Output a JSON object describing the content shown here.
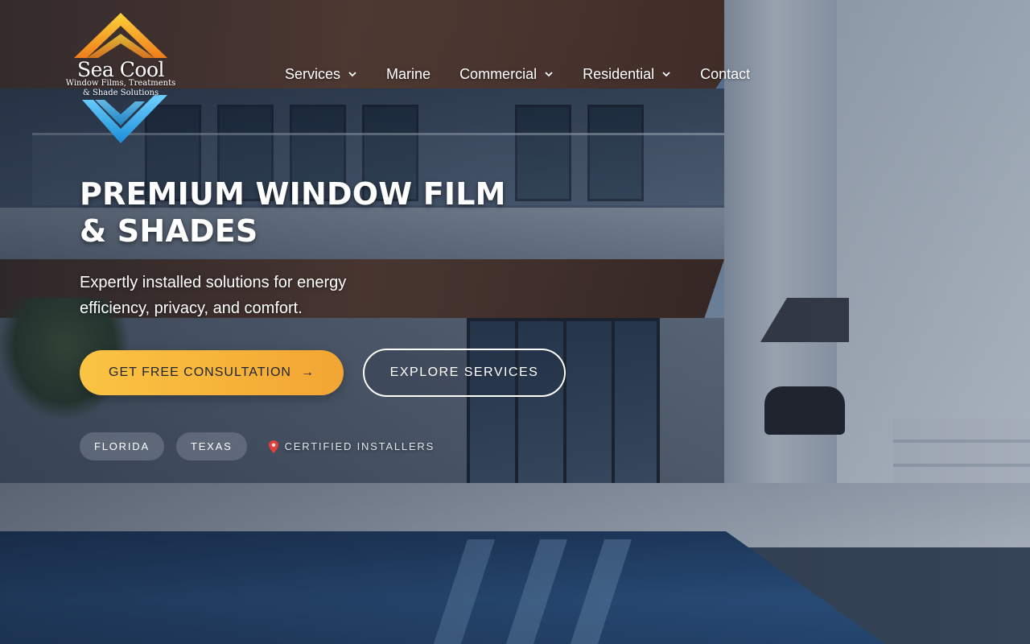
{
  "brand": {
    "name": "Sea Cool",
    "tagline_line1": "Window Films, Treatments",
    "tagline_line2": "& Shade Solutions",
    "logo_colors": {
      "top_chevron": "#f6a623",
      "bottom_chevron": "#2fa8e6"
    }
  },
  "nav": {
    "items": [
      {
        "label": "Services",
        "has_dropdown": true
      },
      {
        "label": "Marine",
        "has_dropdown": false
      },
      {
        "label": "Commercial",
        "has_dropdown": true
      },
      {
        "label": "Residential",
        "has_dropdown": true
      },
      {
        "label": "Contact",
        "has_dropdown": false
      }
    ]
  },
  "hero": {
    "headline_line1": "PREMIUM WINDOW FILM",
    "headline_line2": "& SHADES",
    "subtitle": "Expertly installed solutions for energy efficiency, privacy, and comfort.",
    "primary_cta": {
      "label": "GET FREE CONSULTATION",
      "icon": "arrow-right-icon",
      "arrow": "→",
      "color_start": "#fbc443",
      "color_end": "#f2a533"
    },
    "secondary_cta": {
      "label": "EXPLORE SERVICES"
    },
    "badges": [
      "FLORIDA",
      "TEXAS"
    ],
    "certification": {
      "icon": "map-pin-icon",
      "label": "CERTIFIED INSTALLERS"
    }
  },
  "background": {
    "image": "modern-house-with-pool"
  }
}
